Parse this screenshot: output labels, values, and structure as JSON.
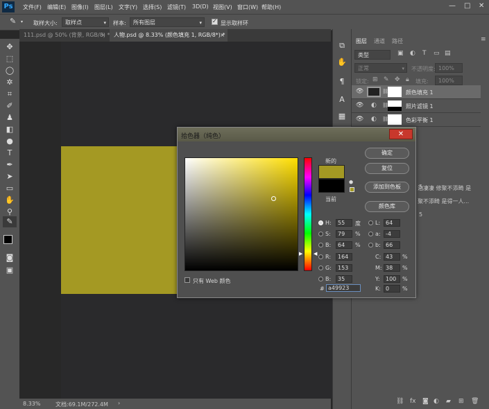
{
  "app": {
    "logo": "Ps"
  },
  "menu": [
    "文件(F)",
    "编辑(E)",
    "图像(I)",
    "图层(L)",
    "文字(Y)",
    "选择(S)",
    "滤镜(T)",
    "3D(D)",
    "视图(V)",
    "窗口(W)",
    "帮助(H)"
  ],
  "window_controls": {
    "minimize": "—",
    "maximize": "□",
    "close": "✕"
  },
  "options": {
    "sample_size_label": "取样大小:",
    "sample_size_value": "取样点",
    "sample_label": "样本:",
    "sample_value": "所有图层",
    "show_ring_label": "显示取样环"
  },
  "tabs": [
    {
      "label": "111.psd @ 50% (背景, RGB/8) *",
      "close": "×"
    },
    {
      "label": "人物.psd @ 8.33% (颜色填充 1, RGB/8*) *",
      "close": "×"
    }
  ],
  "status": {
    "zoom": "8.33%",
    "doc": "文档:69.1M/272.4M"
  },
  "panel": {
    "tabs": [
      "图层",
      "通道",
      "路径"
    ],
    "filter_label": "类型",
    "blend_mode": "正常",
    "opacity_label": "不透明度:",
    "opacity_value": "100%",
    "lock_label": "锁定:",
    "fill_label": "填充:",
    "fill_value": "100%",
    "layers": [
      {
        "name": "颜色填充 1"
      },
      {
        "name": "照片滤镜 1"
      },
      {
        "name": "色彩平衡 1"
      }
    ],
    "behind_texts": [
      "5",
      "泊凄凄 修聚不添畸 是",
      "聚不添畸 是得一人...",
      "5"
    ]
  },
  "picker": {
    "title": "拾色器（纯色）",
    "close": "✕",
    "new_label": "新的",
    "current_label": "当前",
    "new_color": "#a49923",
    "current_color": "#000000",
    "web_only_label": "只有 Web 颜色",
    "buttons": {
      "ok": "确定",
      "reset": "复位",
      "add_swatch": "添加到色板",
      "libraries": "颜色库"
    },
    "hsb": [
      {
        "label": "H:",
        "value": "55",
        "unit": "度",
        "selected": true
      },
      {
        "label": "S:",
        "value": "79",
        "unit": "%",
        "selected": false
      },
      {
        "label": "B:",
        "value": "64",
        "unit": "%",
        "selected": false
      }
    ],
    "rgb": [
      {
        "label": "R:",
        "value": "164"
      },
      {
        "label": "G:",
        "value": "153"
      },
      {
        "label": "B:",
        "value": "35"
      }
    ],
    "lab": [
      {
        "label": "L:",
        "value": "64"
      },
      {
        "label": "a:",
        "value": "-4"
      },
      {
        "label": "b:",
        "value": "66"
      }
    ],
    "cmyk": [
      {
        "label": "C:",
        "value": "43",
        "unit": "%"
      },
      {
        "label": "M:",
        "value": "38",
        "unit": "%"
      },
      {
        "label": "Y:",
        "value": "100",
        "unit": "%"
      },
      {
        "label": "K:",
        "value": "0",
        "unit": "%"
      }
    ],
    "hex_label": "#",
    "hex_value": "a49923"
  },
  "colors": {
    "fill_color": "#a49923"
  }
}
